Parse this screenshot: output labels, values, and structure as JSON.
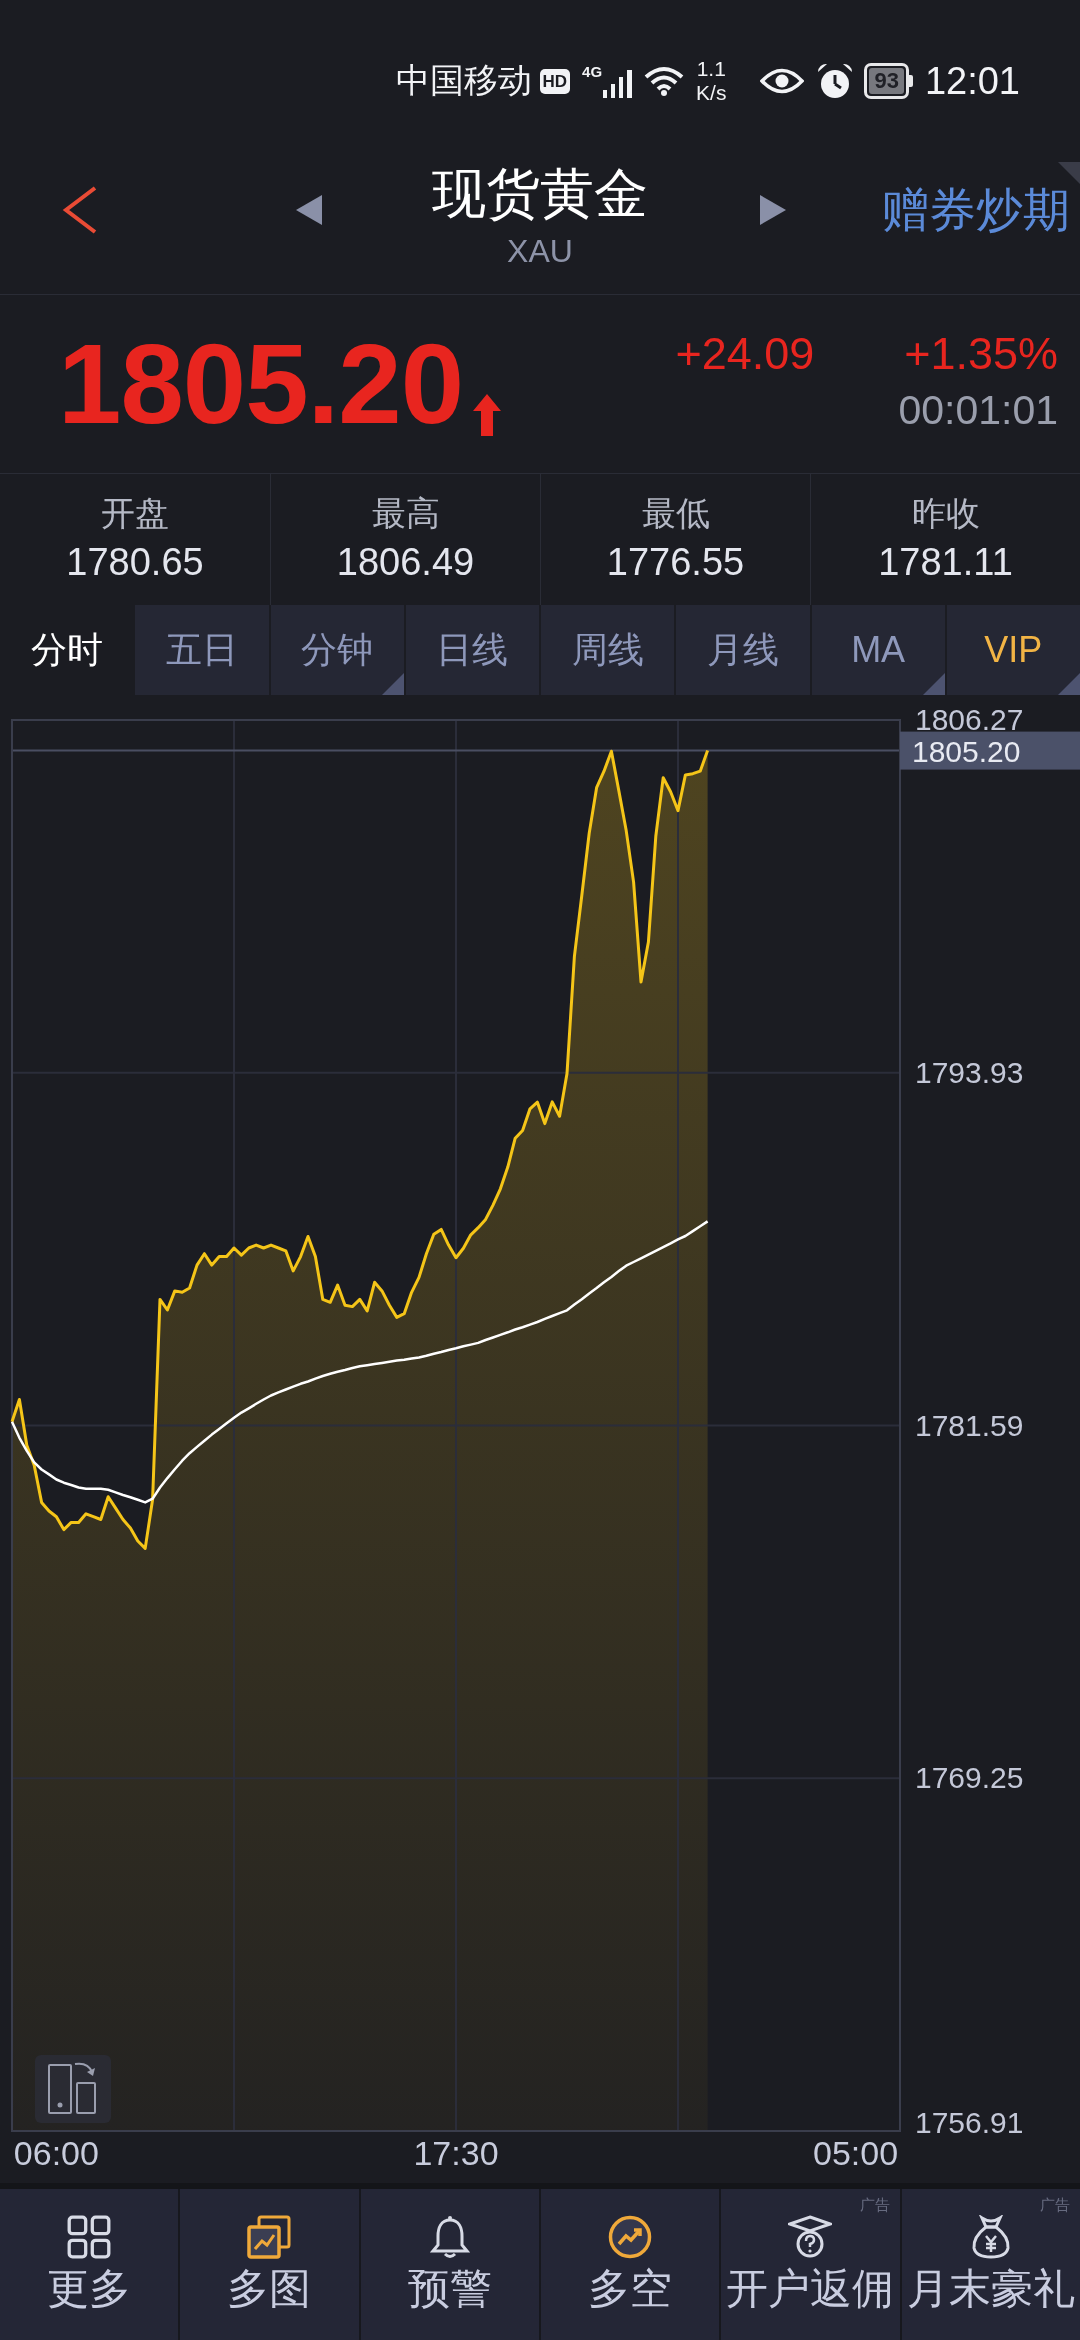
{
  "status_bar": {
    "carrier": "中国移动",
    "hd_badge": "HD",
    "network": "4G",
    "speed_value": "1.1",
    "speed_unit": "K/s",
    "battery": "93",
    "time": "12:01"
  },
  "header": {
    "title": "现货黄金",
    "subtitle": "XAU",
    "promo_link": "赠券炒期"
  },
  "quote": {
    "price": "1805.20",
    "up": true,
    "change": "+24.09",
    "change_percent": "+1.35%",
    "time": "00:01:01"
  },
  "stats": [
    {
      "label": "开盘",
      "value": "1780.65"
    },
    {
      "label": "最高",
      "value": "1806.49"
    },
    {
      "label": "最低",
      "value": "1776.55"
    },
    {
      "label": "昨收",
      "value": "1781.11"
    }
  ],
  "tabs": [
    {
      "label": "分时",
      "kind": "plain",
      "selected": true,
      "has_menu": false
    },
    {
      "label": "五日",
      "kind": "plain",
      "selected": false,
      "has_menu": false
    },
    {
      "label": "分钟",
      "kind": "plain",
      "selected": false,
      "has_menu": true
    },
    {
      "label": "日线",
      "kind": "plain",
      "selected": false,
      "has_menu": false
    },
    {
      "label": "周线",
      "kind": "plain",
      "selected": false,
      "has_menu": false
    },
    {
      "label": "月线",
      "kind": "plain",
      "selected": false,
      "has_menu": false
    },
    {
      "label": "MA",
      "kind": "plain",
      "selected": false,
      "has_menu": true
    },
    {
      "label": "VIP",
      "kind": "vip",
      "selected": false,
      "has_menu": true
    }
  ],
  "chart": {
    "chart_data": {
      "type": "line",
      "grid": true,
      "categories": [
        null,
        null,
        null,
        null,
        null,
        null,
        "06:00",
        null,
        null,
        null,
        null,
        null,
        null,
        null,
        null,
        null,
        null,
        null,
        null,
        null,
        null,
        null,
        null,
        null,
        null,
        null,
        null,
        null,
        null,
        null,
        null,
        null,
        null,
        null,
        null,
        null,
        null,
        null,
        null,
        null,
        null,
        null,
        null,
        null,
        null,
        null,
        null,
        null,
        null,
        null,
        null,
        null,
        null,
        null,
        null,
        null,
        null,
        null,
        null,
        null,
        "17:30",
        null,
        null,
        null,
        null,
        null,
        null,
        null,
        null,
        null,
        null,
        null,
        null,
        null,
        null,
        null,
        null,
        null,
        null,
        null,
        null,
        null,
        null,
        null,
        null,
        null,
        null,
        null,
        null,
        null,
        null,
        null,
        null,
        null,
        null,
        null,
        null,
        null,
        null,
        null,
        null,
        null,
        null,
        null,
        null,
        null,
        null,
        null,
        null,
        null,
        null,
        null,
        null,
        null,
        "05:00",
        null,
        null,
        null,
        null,
        null,
        null
      ],
      "series": [
        {
          "color": "#f5c518",
          "values": [
            1781.72,
            1782.5,
            1780.9,
            1780.2,
            1778.9,
            1778.6,
            1778.4,
            1777.95,
            1778.2,
            1778.2,
            1778.5,
            1778.4,
            1778.3,
            1779.1,
            1778.7,
            1778.3,
            1778.0,
            1777.55,
            1777.29,
            1779.0,
            1786.0,
            1785.63,
            1786.3,
            1786.25,
            1786.4,
            1787.2,
            1787.6,
            1787.2,
            1787.5,
            1787.5,
            1787.8,
            1787.55,
            1787.8,
            1787.9,
            1787.8,
            1787.9,
            1787.8,
            1787.7,
            1787.0,
            1787.5,
            1788.2,
            1787.5,
            1786.0,
            1785.9,
            1786.5,
            1785.8,
            1785.75,
            1786.0,
            1785.6,
            1786.6,
            1786.3,
            1785.8,
            1785.37,
            1785.5,
            1786.25,
            1786.77,
            1787.6,
            1788.28,
            1788.45,
            1787.9,
            1787.46,
            1787.79,
            1788.26,
            1788.51,
            1788.8,
            1789.3,
            1789.87,
            1790.63,
            1791.64,
            1791.91,
            1792.67,
            1792.9,
            1792.15,
            1792.91,
            1792.41,
            1793.9,
            1798.0,
            1800.13,
            1802.31,
            1803.9,
            1804.48,
            1805.18,
            1803.8,
            1802.4,
            1800.6,
            1797.1,
            1798.5,
            1802.2,
            1804.25,
            1803.76,
            1803.1,
            1804.35,
            1804.39,
            1804.48,
            1805.2,
            null,
            null,
            null,
            null,
            null,
            null,
            null,
            null,
            null,
            null,
            null,
            null,
            null,
            null,
            null,
            null,
            null,
            null,
            null,
            null,
            null,
            null,
            null,
            null,
            null,
            null
          ]
        },
        {
          "color": "#ffffff",
          "values": [
            1781.72,
            1781.16,
            1780.7,
            1780.3,
            1780.05,
            1779.88,
            1779.7,
            1779.59,
            1779.51,
            1779.42,
            1779.38,
            1779.38,
            1779.38,
            1779.34,
            1779.25,
            1779.16,
            1779.08,
            1778.99,
            1778.9,
            1779.03,
            1779.42,
            1779.75,
            1780.06,
            1780.36,
            1780.62,
            1780.84,
            1781.06,
            1781.27,
            1781.47,
            1781.67,
            1781.86,
            1782.04,
            1782.19,
            1782.35,
            1782.5,
            1782.64,
            1782.75,
            1782.85,
            1782.95,
            1783.05,
            1783.13,
            1783.23,
            1783.32,
            1783.4,
            1783.47,
            1783.53,
            1783.6,
            1783.66,
            1783.7,
            1783.74,
            1783.78,
            1783.82,
            1783.86,
            1783.89,
            1783.93,
            1783.97,
            1784.03,
            1784.1,
            1784.16,
            1784.23,
            1784.29,
            1784.36,
            1784.42,
            1784.48,
            1784.58,
            1784.67,
            1784.76,
            1784.85,
            1784.95,
            1785.03,
            1785.12,
            1785.21,
            1785.32,
            1785.42,
            1785.52,
            1785.62,
            1785.82,
            1786.01,
            1786.21,
            1786.4,
            1786.6,
            1786.79,
            1786.99,
            1787.18,
            1787.31,
            1787.44,
            1787.57,
            1787.7,
            1787.83,
            1787.96,
            1788.1,
            1788.22,
            1788.39,
            1788.56,
            1788.73,
            null,
            null,
            null,
            null,
            null,
            null,
            null,
            null,
            null,
            null,
            null,
            null,
            null,
            null,
            null,
            null,
            null,
            null,
            null,
            null,
            null,
            null,
            null,
            null,
            null,
            null
          ]
        }
      ],
      "ylim": [
        1756.91,
        1806.27
      ],
      "yticks": [
        1756.91,
        1769.25,
        1781.59,
        1793.93,
        1806.27
      ],
      "ref_lines": [
        {
          "axis": "y",
          "value": 1805.2,
          "label": "1805.20"
        }
      ]
    }
  },
  "bottom_nav": [
    {
      "label": "更多"
    },
    {
      "label": "多图"
    },
    {
      "label": "预警"
    },
    {
      "label": "多空"
    },
    {
      "label": "开户返佣",
      "ad_tag": "广告"
    },
    {
      "label": "月末豪礼",
      "ad_tag": "广告"
    }
  ]
}
